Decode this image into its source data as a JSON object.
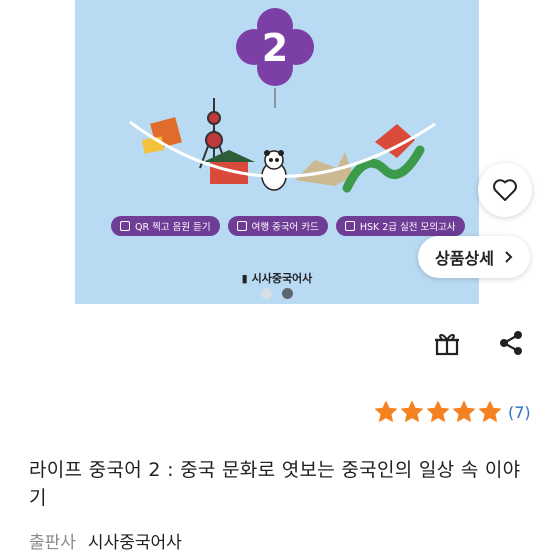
{
  "hero": {
    "badge_number": "2",
    "chips": [
      {
        "label": "QR 찍고 음원 듣기",
        "icon": "qr-icon"
      },
      {
        "label": "여행 중국어 카드",
        "icon": "card-icon"
      },
      {
        "label": "HSK 2급 실전 모의고사",
        "icon": "edit-icon"
      }
    ],
    "publisher_logo": "시사중국어사",
    "carousel": {
      "total": 2,
      "active": 2
    }
  },
  "actions": {
    "wishlist_icon": "heart-icon",
    "detail_label": "상품상세",
    "gift_icon": "gift-icon",
    "share_icon": "share-icon"
  },
  "rating": {
    "stars": 5,
    "review_count": "(7)",
    "star_color": "#f58220"
  },
  "product": {
    "title": "라이프 중국어 2 : 중국 문화로 엿보는 중국인의 일상 속 이야기",
    "publisher_label": "출판사",
    "publisher_value": "시사중국어사"
  },
  "colors": {
    "hero_bg": "#b9daf3",
    "accent_purple": "#6f3c96",
    "link_blue": "#2b73c6"
  }
}
